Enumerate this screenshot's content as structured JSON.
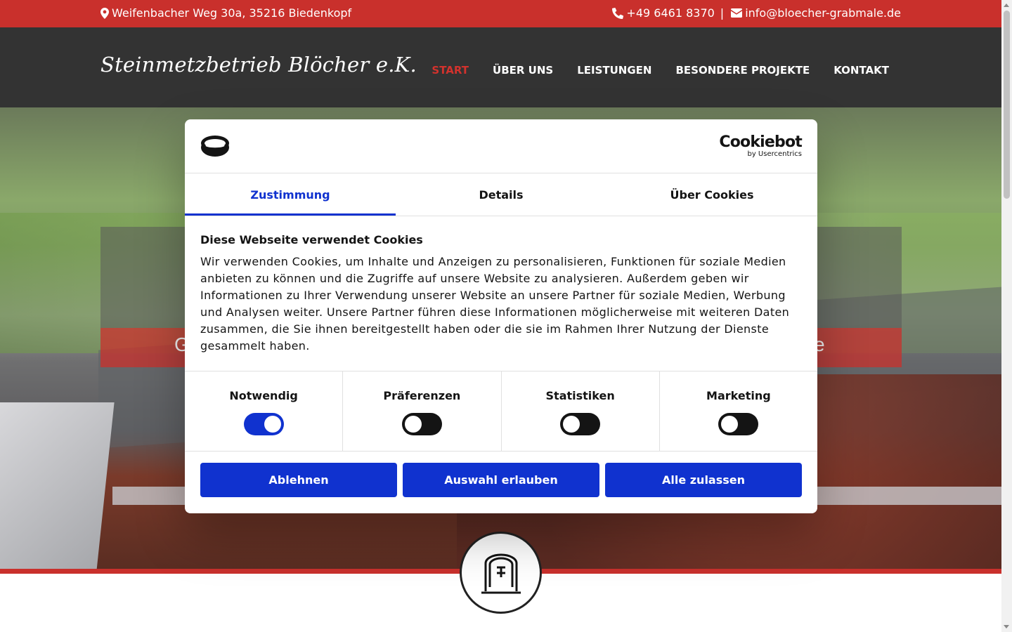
{
  "topbar": {
    "address": "Weifenbacher Weg 30a, 35216 Biedenkopf",
    "phone": "+49 6461 8370",
    "separator": "|",
    "email": "info@bloecher-grabmale.de"
  },
  "header": {
    "brand": "Steinmetzbetrieb Blöcher e.K.",
    "nav": [
      {
        "label": "START",
        "active": true
      },
      {
        "label": "ÜBER UNS"
      },
      {
        "label": "LEISTUNGEN"
      },
      {
        "label": "BESONDERE PROJEKTE"
      },
      {
        "label": "KONTAKT"
      }
    ]
  },
  "hero": {
    "partial_left": "G",
    "partial_right": "e"
  },
  "cookie": {
    "brand_name": "Cookiebot",
    "brand_by": "by Usercentrics",
    "tabs": [
      "Zustimmung",
      "Details",
      "Über Cookies"
    ],
    "title": "Diese Webseite verwendet Cookies",
    "text": "Wir verwenden Cookies, um Inhalte und Anzeigen zu personalisieren, Funktionen für soziale Medien anbieten zu können und die Zugriffe auf unsere Website zu analysieren. Außerdem geben wir Informationen zu Ihrer Verwendung unserer Website an unsere Partner für soziale Medien, Werbung und Analysen weiter. Unsere Partner führen diese Informationen möglicherweise mit weiteren Daten zusammen, die Sie ihnen bereitgestellt haben oder die sie im Rahmen Ihrer Nutzung der Dienste gesammelt haben.",
    "toggles": [
      {
        "label": "Notwendig",
        "on": true
      },
      {
        "label": "Präferenzen",
        "on": false
      },
      {
        "label": "Statistiken",
        "on": false
      },
      {
        "label": "Marketing",
        "on": false
      }
    ],
    "buttons": {
      "decline": "Ablehnen",
      "allow_selection": "Auswahl erlauben",
      "allow_all": "Alle zulassen"
    }
  },
  "colors": {
    "brand_red": "#c9302c",
    "header_dark": "#333333",
    "cookiebot_blue": "#1032cf"
  }
}
